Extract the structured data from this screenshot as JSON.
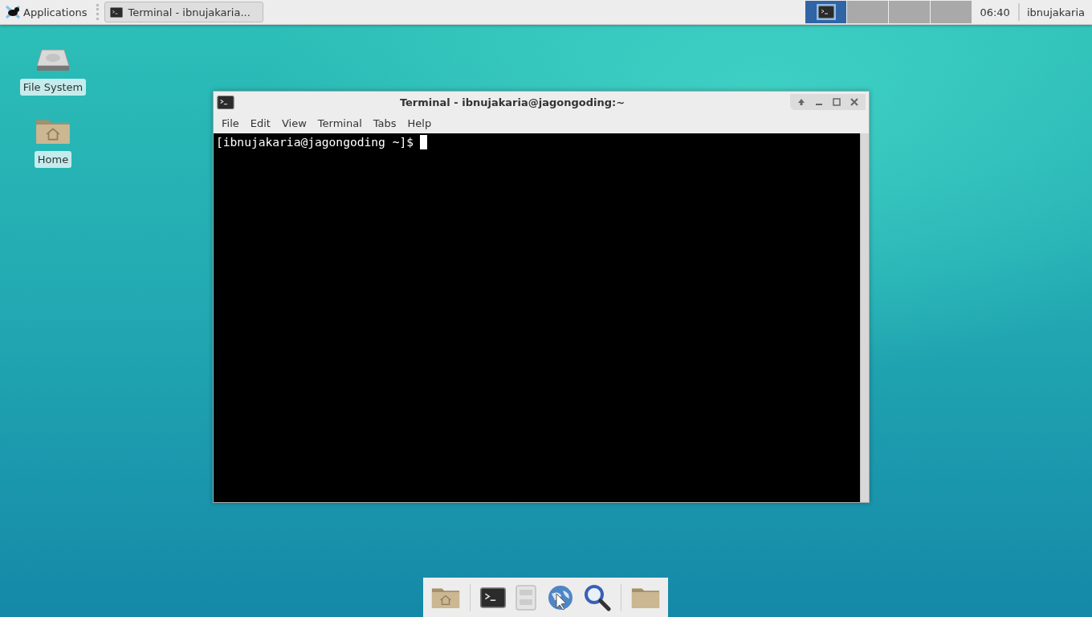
{
  "panel": {
    "applications_label": "Applications",
    "task_button": {
      "title": "Terminal - ibnujakaria..."
    },
    "workspaces": [
      {
        "selected": true,
        "has_window": true
      },
      {
        "selected": false,
        "has_window": false
      },
      {
        "selected": false,
        "has_window": false
      },
      {
        "selected": false,
        "has_window": false
      }
    ],
    "clock": "06:40",
    "user": "ibnujakaria"
  },
  "desktop_icons": [
    {
      "kind": "drive",
      "label": "File System"
    },
    {
      "kind": "home",
      "label": "Home"
    }
  ],
  "window": {
    "title": "Terminal - ibnujakaria@jagongoding:~",
    "menu": [
      "File",
      "Edit",
      "View",
      "Terminal",
      "Tabs",
      "Help"
    ],
    "prompt": "[ibnujakaria@jagongoding ~]$"
  },
  "dock_groups": [
    {
      "items": [
        {
          "kind": "home-folder"
        }
      ]
    },
    {
      "items": [
        {
          "kind": "terminal"
        },
        {
          "kind": "cabinet"
        },
        {
          "kind": "globe"
        },
        {
          "kind": "search"
        }
      ]
    },
    {
      "items": [
        {
          "kind": "folder"
        }
      ]
    }
  ]
}
